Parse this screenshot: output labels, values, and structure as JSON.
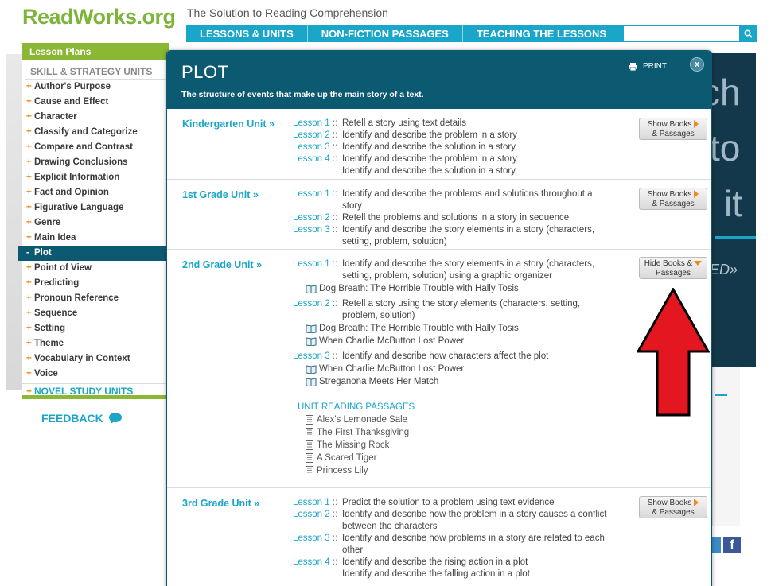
{
  "header": {
    "logo": "ReadWorks.org",
    "tagline": "The Solution to Reading Comprehension",
    "nav": [
      "LESSONS & UNITS",
      "NON-FICTION PASSAGES",
      "TEACHING THE LESSONS"
    ],
    "search_placeholder": ""
  },
  "sidebar": {
    "title": "Lesson Plans",
    "section": "SKILL & STRATEGY UNITS",
    "items": [
      {
        "sym": "+",
        "label": "Author's Purpose"
      },
      {
        "sym": "+",
        "label": "Cause and Effect"
      },
      {
        "sym": "+",
        "label": "Character"
      },
      {
        "sym": "+",
        "label": "Classify and Categorize"
      },
      {
        "sym": "+",
        "label": "Compare and Contrast"
      },
      {
        "sym": "+",
        "label": "Drawing Conclusions"
      },
      {
        "sym": "+",
        "label": "Explicit Information"
      },
      {
        "sym": "+",
        "label": "Fact and Opinion"
      },
      {
        "sym": "+",
        "label": "Figurative Language"
      },
      {
        "sym": "+",
        "label": "Genre"
      },
      {
        "sym": "+",
        "label": "Main Idea"
      },
      {
        "sym": "-",
        "label": "Plot"
      },
      {
        "sym": "+",
        "label": "Point of View"
      },
      {
        "sym": "+",
        "label": "Predicting"
      },
      {
        "sym": "+",
        "label": "Pronoun Reference"
      },
      {
        "sym": "+",
        "label": "Sequence"
      },
      {
        "sym": "+",
        "label": "Setting"
      },
      {
        "sym": "+",
        "label": "Theme"
      },
      {
        "sym": "+",
        "label": "Vocabulary in Context"
      },
      {
        "sym": "+",
        "label": "Voice"
      }
    ],
    "novel": {
      "sym": "+",
      "label": "NOVEL STUDY UNITS"
    },
    "feedback": "FEEDBACK"
  },
  "background": {
    "big_1": "ch",
    "big_2": "to",
    "big_3": "it",
    "italic": "ED»"
  },
  "modal": {
    "title": "PLOT",
    "subtitle": "The structure of events that make up the main story of a text.",
    "print": "PRINT",
    "close": "x",
    "units": [
      {
        "title": "Kindergarten Unit »",
        "button": [
          "Show Books",
          "& Passages"
        ],
        "lessons": [
          {
            "link": "Lesson 1",
            "lines": [
              "Retell a story using text details"
            ]
          },
          {
            "link": "Lesson 2",
            "lines": [
              "Identify and describe the problem in a story"
            ]
          },
          {
            "link": "Lesson 3",
            "lines": [
              "Identify and describe the solution in a story"
            ]
          },
          {
            "link": "Lesson 4",
            "lines": [
              "Identify and describe the problem in a story",
              "Identify and describe the solution in a story"
            ]
          }
        ]
      },
      {
        "title": "1st Grade Unit »",
        "button": [
          "Show Books",
          "& Passages"
        ],
        "lessons": [
          {
            "link": "Lesson 1",
            "lines": [
              "Identify and describe the problems and solutions throughout a",
              "story"
            ]
          },
          {
            "link": "Lesson 2",
            "lines": [
              "Retell the problems and solutions in a story in sequence"
            ]
          },
          {
            "link": "Lesson 3",
            "lines": [
              "Identify and describe the story elements in a story (characters,",
              "setting, problem, solution)"
            ]
          }
        ]
      },
      {
        "title": "2nd Grade Unit »",
        "button": [
          "Hide Books &",
          "Passages"
        ],
        "lessons": [
          {
            "link": "Lesson 1",
            "lines": [
              "Identify and describe the story elements in a story (characters,",
              "setting, problem, solution) using a graphic organizer"
            ],
            "books": [
              "Dog Breath: The Horrible Trouble with Hally Tosis"
            ]
          },
          {
            "link": "Lesson 2",
            "lines": [
              "Retell a story using the story elements (characters, setting,",
              "problem, solution)"
            ],
            "books": [
              "Dog Breath: The Horrible Trouble with Hally Tosis",
              "When Charlie McButton Lost Power"
            ]
          },
          {
            "link": "Lesson 3",
            "lines": [
              "Identify and describe how characters affect the plot"
            ],
            "books": [
              "When Charlie McButton Lost Power",
              "Streganona Meets Her Match"
            ]
          }
        ],
        "passages_title": "UNIT READING PASSAGES",
        "passages": [
          "Alex's Lemonade Sale",
          "The First Thanksgiving",
          "The Missing Rock",
          "A Scared Tiger",
          "Princess Lily"
        ]
      },
      {
        "title": "3rd Grade Unit »",
        "button": [
          "Show Books",
          "& Passages"
        ],
        "lessons": [
          {
            "link": "Lesson 1",
            "lines": [
              "Predict the solution to a problem using text evidence"
            ]
          },
          {
            "link": "Lesson 2",
            "lines": [
              "Identify and describe how the problem in a story causes a conflict",
              "between the characters"
            ]
          },
          {
            "link": "Lesson 3",
            "lines": [
              "Identify and describe how problems in a story are related to each",
              "other"
            ]
          },
          {
            "link": "Lesson 4",
            "lines": [
              "Identify and describe the rising action in a plot",
              "Identify and describe the falling action in a plot"
            ]
          }
        ]
      }
    ]
  },
  "colors": {
    "brand_green": "#7cb53a",
    "nav_blue": "#1aa6c9",
    "modal_teal": "#0c5a72",
    "accent_orange": "#f08a1d",
    "annotation_red": "#e4161f"
  }
}
